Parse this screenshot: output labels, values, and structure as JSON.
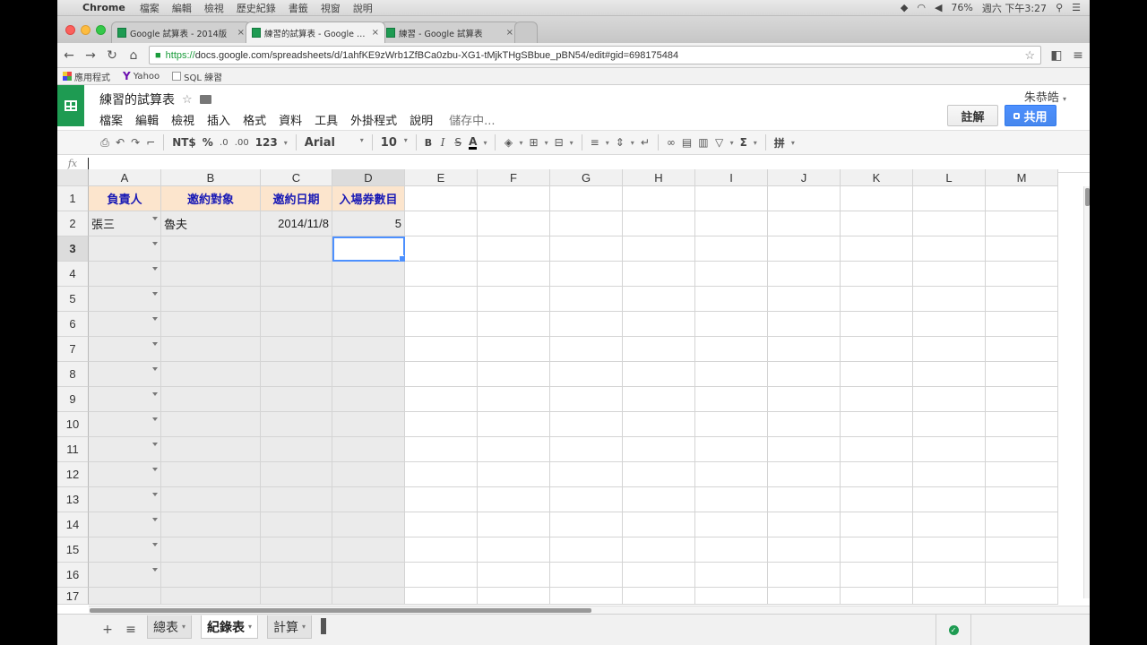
{
  "mac_menubar": {
    "app_name": "Chrome",
    "menus": [
      "檔案",
      "編輯",
      "檢視",
      "歷史紀錄",
      "書籤",
      "視窗",
      "說明"
    ],
    "battery": "76%",
    "clock": "週六 下午3:27"
  },
  "browser": {
    "tabs": [
      {
        "title": "Google 試算表 - 2014版",
        "active": false
      },
      {
        "title": "練習的試算表 - Google 試算",
        "active": true
      },
      {
        "title": "練習 - Google 試算表",
        "active": false
      }
    ],
    "url_scheme": "https://",
    "url_rest": "docs.google.com/spreadsheets/d/1ahfKE9zWrb1ZfBCa0zbu-XG1-tMjkTHgSBbue_pBN54/edit#gid=698175484",
    "bookmarks": [
      "應用程式",
      "Yahoo",
      "SQL 練習"
    ]
  },
  "doc": {
    "title": "練習的試算表",
    "menu": [
      "檔案",
      "編輯",
      "檢視",
      "插入",
      "格式",
      "資料",
      "工具",
      "外掛程式",
      "說明"
    ],
    "saving_status": "儲存中...",
    "user_name": "朱恭皓",
    "comment_label": "註解",
    "share_label": "共用"
  },
  "format_toolbar": {
    "currency": "NT$",
    "percent": "%",
    "decimal_less": ".0",
    "decimal_more": ".00",
    "more_formats": "123",
    "font": "Arial",
    "font_size": "10",
    "bold": "B",
    "italic": "I",
    "strike": "S",
    "text_color": "A",
    "sum": "Σ",
    "input_tools": "拼"
  },
  "formula_bar": {
    "fx_label": "fx",
    "value": ""
  },
  "grid": {
    "columns": [
      "A",
      "B",
      "C",
      "D",
      "E",
      "F",
      "G",
      "H",
      "I",
      "J",
      "K",
      "L",
      "M"
    ],
    "rows": [
      "1",
      "2",
      "3",
      "4",
      "5",
      "6",
      "7",
      "8",
      "9",
      "10",
      "11",
      "12",
      "13",
      "14",
      "15",
      "16",
      "17"
    ],
    "header_row": [
      "負責人",
      "邀約對象",
      "邀約日期",
      "入場券數目"
    ],
    "data_row": [
      "張三",
      "魯夫",
      "2014/11/8",
      "5"
    ],
    "selected_cell": "D3",
    "colors": {
      "header_fill": "#fce5cd",
      "header_text": "#1a1ab5",
      "protected_fill": "#ebebeb",
      "selection": "#4d90fe"
    }
  },
  "sheets": {
    "tabs": [
      {
        "name": "總表",
        "active": false
      },
      {
        "name": "紀錄表",
        "active": true
      },
      {
        "name": "計算",
        "active": false
      }
    ],
    "add_label": "+",
    "list_label": "≡"
  }
}
